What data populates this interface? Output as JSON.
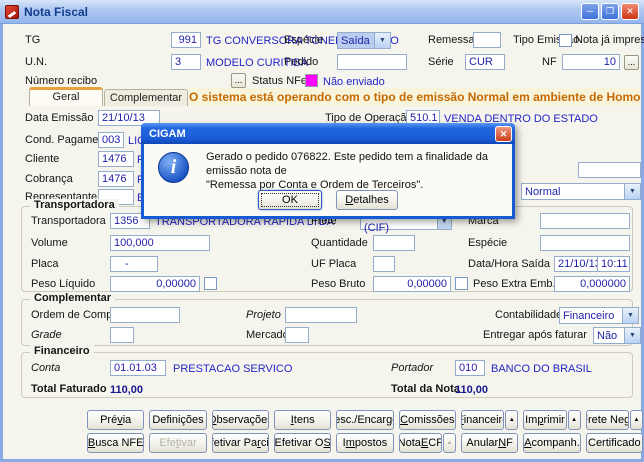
{
  "colors": {
    "status_nfe_swatch": "#ff00ff",
    "warning_text": "#cc6600",
    "field_text": "#1f1fa8",
    "lookup_text": "#2525c8",
    "tab_accent": "#e8a33d"
  },
  "window": {
    "title": "Nota Fiscal",
    "controls": {
      "minimize": "─",
      "maximize": "❐",
      "close": "✕"
    }
  },
  "top": {
    "tg": {
      "label": "TG",
      "code": "991",
      "desc": "TG CONVERSORA TONELADA-SACO"
    },
    "especie": {
      "label": "Espécie",
      "value": "Saída"
    },
    "remessa": {
      "label": "Remessa",
      "value": ""
    },
    "tipo_emissao": {
      "label": "Tipo Emissão"
    },
    "nota_impressa": {
      "label": "Nota já impressa",
      "checked": false
    },
    "un": {
      "label": "U.N.",
      "code": "3",
      "desc": "MODELO CURITIBA"
    },
    "pedido": {
      "label": "Pedido",
      "value": ""
    },
    "serie": {
      "label": "Série",
      "value": "CUR"
    },
    "nf": {
      "label": "NF",
      "value": "10",
      "browse": "..."
    },
    "numero_recibo": {
      "label": "Número recibo",
      "browse": "..."
    },
    "status_nfe": {
      "label": "Status NFe",
      "value": "Não enviado"
    }
  },
  "tabs": {
    "geral": "Geral",
    "complementar": "Complementar"
  },
  "warning": "O sistema está operando com o tipo de emissão Normal em ambiente de Homologação",
  "geral": {
    "data_emissao": {
      "label": "Data Emissão",
      "value": "21/10/13"
    },
    "tipo_operacao": {
      "label": "Tipo de Operação",
      "code": "510.1",
      "desc": "VENDA DENTRO DO ESTADO"
    },
    "cond_pagamento": {
      "label": "Cond. Pagamento",
      "code": "003",
      "desc_fragment": "LIQUI"
    },
    "cliente": {
      "label": "Cliente",
      "code": "1476",
      "desc_fragment": "R"
    },
    "cobranca": {
      "label": "Cobrança",
      "code": "1476",
      "desc_fragment": "R"
    },
    "representante": {
      "label": "Representante",
      "code": "",
      "desc_fragment": "E"
    },
    "side_field": {
      "value": ""
    },
    "side_combo": {
      "value": "Normal"
    }
  },
  "dialog": {
    "title": "CIGAM",
    "line1": "Gerado o pedido 076822. Este pedido tem a finalidade da emissão nota de",
    "line2": "\"Remessa por Conta e Ordem de Terceiros\".",
    "ok": "OK",
    "detalhes": {
      "pre": "",
      "key": "D",
      "post": "etalhes"
    },
    "close": "✕"
  },
  "transportadora": {
    "title": "Transportadora",
    "transportadora": {
      "label": "Transportadora",
      "code": "1356",
      "desc": "TRANSPORTADORA RAPIDA LTDA"
    },
    "frete": {
      "label": "Frete",
      "value": "1 Emitente (CIF)"
    },
    "marca": {
      "label": "Marca",
      "value": ""
    },
    "volume": {
      "label": "Volume",
      "value": "100,000"
    },
    "quantidade": {
      "label": "Quantidade",
      "value": ""
    },
    "especie": {
      "label": "Espécie",
      "value": ""
    },
    "placa": {
      "label": "Placa",
      "value": "-"
    },
    "uf_placa": {
      "label": "UF Placa",
      "value": ""
    },
    "data_hora_saida": {
      "label": "Data/Hora Saída",
      "date": "21/10/13",
      "time": "10:11"
    },
    "peso_liquido": {
      "label": "Peso Líquido",
      "value": "0,00000",
      "checked": false
    },
    "peso_bruto": {
      "label": "Peso Bruto",
      "value": "0,00000",
      "checked": false
    },
    "peso_extra": {
      "label": "Peso Extra Emb.",
      "value": "0,000000"
    }
  },
  "complementar": {
    "title": "Complementar",
    "ordem_compra": {
      "label": "Ordem de Compra",
      "value": ""
    },
    "projeto": {
      "label": "Projeto",
      "value": ""
    },
    "contabilidade": {
      "label": "Contabilidade",
      "value": "Financeiro"
    },
    "grade": {
      "label": "Grade",
      "value": ""
    },
    "mercado": {
      "label": "Mercado",
      "value": ""
    },
    "entregar": {
      "label": "Entregar após faturar",
      "value": "Não"
    }
  },
  "financeiro": {
    "title": "Financeiro",
    "conta": {
      "label": "Conta",
      "code": "01.01.03",
      "desc": "PRESTACAO SERVICO"
    },
    "portador": {
      "label": "Portador",
      "code": "010",
      "desc": "BANCO DO BRASIL"
    },
    "total_faturado": {
      "label": "Total Faturado",
      "value": "110,00"
    },
    "total_nota": {
      "label": "Total da Nota",
      "value": "110,00"
    }
  },
  "buttons": {
    "row1": [
      {
        "name": "previa",
        "pre": "Pré",
        "key": "v",
        "post": "ia"
      },
      {
        "name": "definicoes",
        "pre": "Definições",
        "key": "",
        "post": ""
      },
      {
        "name": "observacoes",
        "pre": "",
        "key": "O",
        "post": "bservações"
      },
      {
        "name": "itens",
        "pre": "",
        "key": "I",
        "post": "tens"
      },
      {
        "name": "desc-encargos",
        "pre": "",
        "key": "D",
        "post": "esc./Encargos"
      },
      {
        "name": "comissoes",
        "pre": "",
        "key": "C",
        "post": "omissões"
      },
      {
        "name": "financeiro",
        "pre": "",
        "key": "F",
        "post": "inanceiro",
        "arrow": true
      },
      {
        "name": "imprimir",
        "pre": "Im",
        "key": "p",
        "post": "rimir",
        "arrow": true
      },
      {
        "name": "frete-neg",
        "pre": "Frete Ne",
        "key": "g",
        "post": ".",
        "arrow": true
      }
    ],
    "row2": [
      {
        "name": "busca-nfe",
        "pre": "",
        "key": "B",
        "post": "usca NFE"
      },
      {
        "name": "efetivar",
        "pre": "Efe",
        "key": "t",
        "post": "ivar",
        "disabled": true
      },
      {
        "name": "efetivar-parcial",
        "pre": "Efetivar Pa",
        "key": "r",
        "post": "cial"
      },
      {
        "name": "efetivar-os",
        "pre": "Efetivar O",
        "key": "S",
        "post": ""
      },
      {
        "name": "impostos",
        "pre": "I",
        "key": "m",
        "post": "postos"
      },
      {
        "name": "nota-ecf",
        "pre": "Nota ",
        "key": "E",
        "post": "CF",
        "arrow": true,
        "arrow_disabled": true
      },
      {
        "name": "anular-nf",
        "pre": "Anular ",
        "key": "N",
        "post": "F"
      },
      {
        "name": "acompanh",
        "pre": "",
        "key": "A",
        "post": "companh."
      },
      {
        "name": "certificado",
        "pre": "Certificado",
        "key": "",
        "post": ""
      }
    ]
  }
}
